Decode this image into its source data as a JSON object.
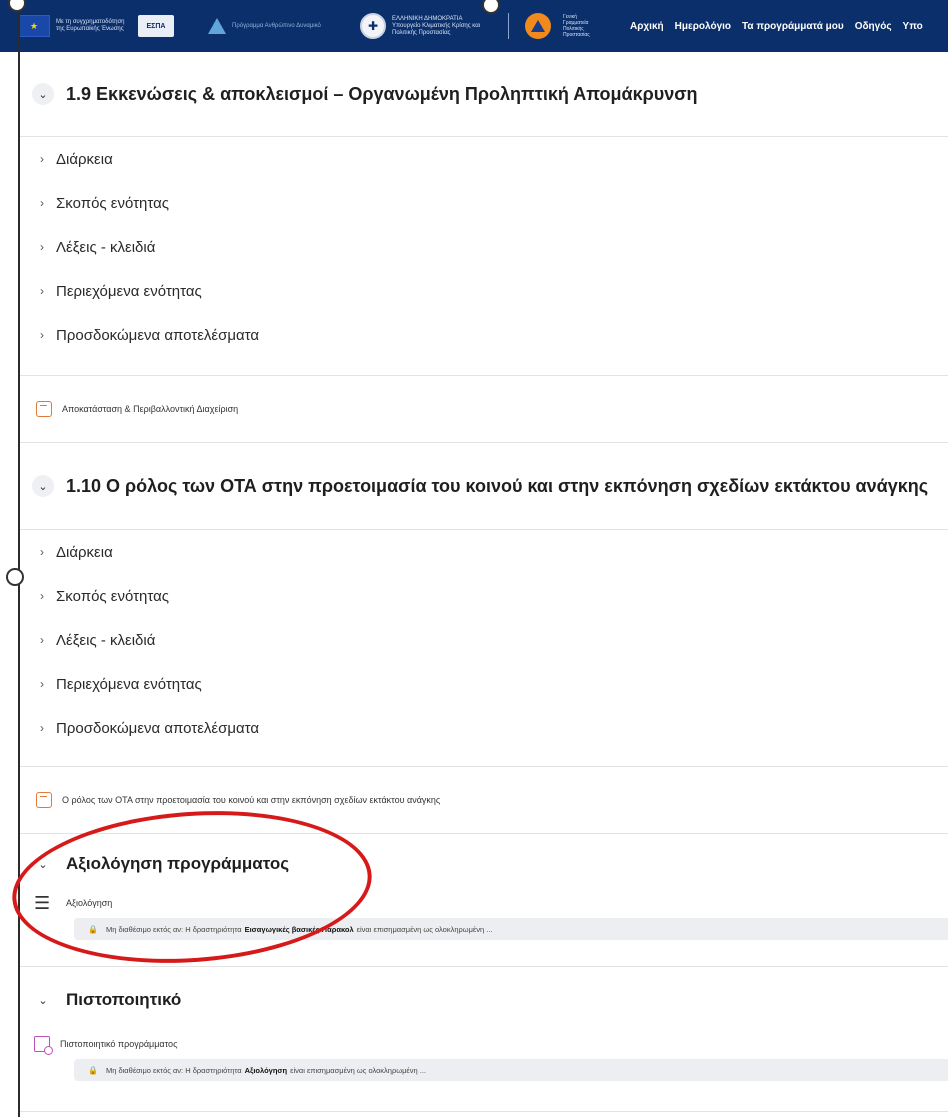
{
  "header": {
    "eu_logo_text": "Με τη συγχρηματοδότηση της Ευρωπαϊκής Ένωσης",
    "espa_label": "ΕΣΠΑ",
    "mid_logo_text": "Πρόγραμμα Ανθρώπινο Δυναμικό",
    "gov_logo_text": "ΕΛΛΗΝΙΚΗ ΔΗΜΟΚΡΑΤΙΑ Υπουργείο Κλιματικής Κρίσης και Πολιτικής Προστασίας",
    "civ_logo_text": "Γενική Γραμματεία Πολιτικής Προστασίας",
    "nav": [
      "Αρχική",
      "Ημερολόγιο",
      "Τα προγράμματά μου",
      "Οδηγός",
      "Υπο"
    ]
  },
  "sections": [
    {
      "title": "1.9 Εκκενώσεις & αποκλεισμοί – Οργανωμένη Προληπτική Απομάκρυνση",
      "items": [
        "Διάρκεια",
        "Σκοπός ενότητας",
        "Λέξεις - κλειδιά",
        "Περιεχόμενα ενότητας",
        "Προσδοκώμενα αποτελέσματα"
      ],
      "resource": "Αποκατάσταση & Περιβαλλοντική Διαχείριση"
    },
    {
      "title": "1.10 Ο ρόλος των ΟΤΑ στην προετοιμασία του κοινού και στην εκπόνηση σχεδίων εκτάκτου ανάγκης",
      "items": [
        "Διάρκεια",
        "Σκοπός ενότητας",
        "Λέξεις - κλειδιά",
        "Περιεχόμενα ενότητας",
        "Προσδοκώμενα αποτελέσματα"
      ],
      "resource": "Ο ρόλος των ΟΤΑ στην προετοιμασία του κοινού και στην εκπόνηση σχεδίων εκτάκτου ανάγκης"
    }
  ],
  "evaluation": {
    "title": "Αξιολόγηση προγράμματος",
    "activity": "Αξιολόγηση",
    "restriction_prefix": "Μη διαθέσιμο εκτός αν: Η δραστηριότητα",
    "restriction_bold": "Εισαγωγικές βασικές Παρακολ",
    "restriction_suffix": "είναι επισημασμένη ως ολοκληρωμένη ..."
  },
  "certificate": {
    "title": "Πιστοποιητικό",
    "activity": "Πιστοποιητικό προγράμματος",
    "restriction_prefix": "Μη διαθέσιμο εκτός αν: Η δραστηριότητα",
    "restriction_bold": "Αξιολόγηση",
    "restriction_suffix": "είναι επισημασμένη ως ολοκληρωμένη ..."
  },
  "colors": {
    "header_bg": "#0b2f6b",
    "annotation_red": "#d61a1a",
    "resource_icon": "#e07a3b",
    "certificate_icon": "#c04fb8"
  },
  "icons": {
    "section_toggle": "chevron-down-icon",
    "item_toggle": "chevron-right-icon",
    "resource": "package-icon",
    "evaluation": "checklist-icon",
    "certificate": "certificate-icon",
    "restriction": "lock-icon"
  }
}
